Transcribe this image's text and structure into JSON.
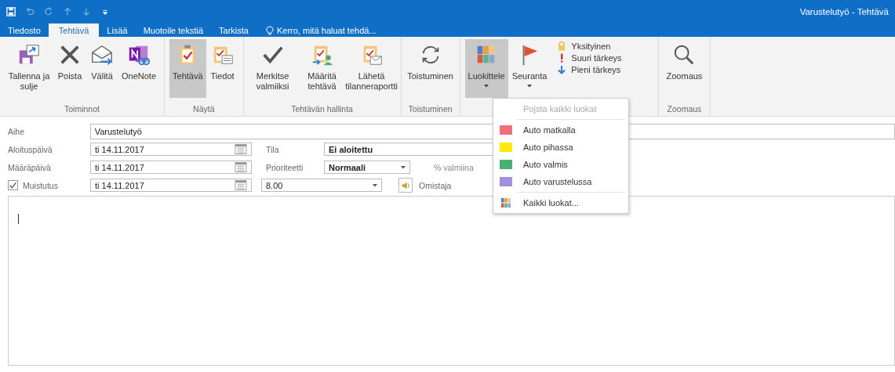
{
  "window": {
    "title": "Varustelutyö - Tehtävä"
  },
  "tabs": [
    {
      "label": "Tiedosto",
      "selected": false
    },
    {
      "label": "Tehtävä",
      "selected": true
    },
    {
      "label": "Lisää",
      "selected": false
    },
    {
      "label": "Muotoile tekstiä",
      "selected": false
    },
    {
      "label": "Tarkista",
      "selected": false
    }
  ],
  "tell_me": {
    "placeholder": "Kerro, mitä haluat tehdä..."
  },
  "ribbon_groups": [
    {
      "label": "Toiminnot",
      "buttons": [
        {
          "label": "Tallenna ja sulje",
          "selected": false
        },
        {
          "label": "Poista",
          "selected": false
        },
        {
          "label": "Välitä",
          "selected": false
        },
        {
          "label": "OneNote",
          "selected": false
        }
      ]
    },
    {
      "label": "Näytä",
      "buttons": [
        {
          "label": "Tehtävä",
          "selected": true
        },
        {
          "label": "Tiedot",
          "selected": false
        }
      ]
    },
    {
      "label": "Tehtävän hallinta",
      "buttons": [
        {
          "label": "Merkitse valmiiksi",
          "selected": false
        },
        {
          "label": "Määritä tehtävä",
          "selected": false
        },
        {
          "label": "Lähetä tilanneraportti",
          "selected": false
        }
      ]
    },
    {
      "label": "Toistuminen",
      "buttons": [
        {
          "label": "Toistuminen",
          "selected": false
        }
      ]
    },
    {
      "buttons": [
        {
          "label": "Luokittele",
          "selected": true,
          "dropdown": true
        },
        {
          "label": "Seuranta",
          "selected": false,
          "dropdown": true
        }
      ],
      "small_buttons": [
        "Yksityinen",
        "Suuri tärkeys",
        "Pieni tärkeys"
      ]
    },
    {
      "label": "Zoomaus",
      "buttons": [
        {
          "label": "Zoomaus",
          "selected": false
        }
      ]
    }
  ],
  "form": {
    "subject": {
      "label": "Aihe",
      "value": "Varustelutyö"
    },
    "start_date": {
      "label": "Aloituspäivä",
      "value": "ti 14.11.2017"
    },
    "due_date": {
      "label": "Määräpäivä",
      "value": "ti 14.11.2017"
    },
    "reminder": {
      "label": "Muistutus",
      "checked": true,
      "date": "ti 14.11.2017",
      "time": "8.00"
    },
    "status": {
      "label": "Tila",
      "value": "Ei aloitettu"
    },
    "priority": {
      "label": "Prioriteetti",
      "value": "Normaali"
    },
    "percent_complete": {
      "label": "% valmiina"
    },
    "owner": {
      "label": "Omistaja"
    }
  },
  "category_menu": {
    "clear": {
      "label": "Pojsta kaikki luokat",
      "disabled": true
    },
    "categories": [
      {
        "label": "Auto matkalla",
        "color": "#f0707a"
      },
      {
        "label": "Auto pihassa",
        "color": "#fde910"
      },
      {
        "label": "Auto valmis",
        "color": "#4caf72"
      },
      {
        "label": "Auto varustelussa",
        "color": "#a08ee0"
      }
    ],
    "all": {
      "label": "Kaikki luokat..."
    }
  }
}
